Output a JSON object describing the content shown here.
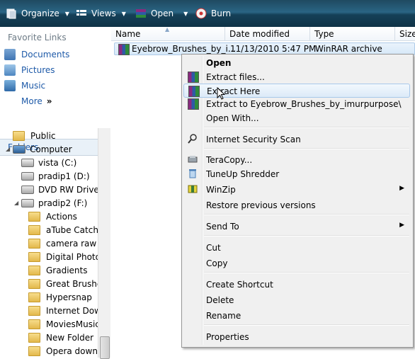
{
  "toolbar": {
    "organize": "Organize",
    "views": "Views",
    "open": "Open",
    "burn": "Burn"
  },
  "nav": {
    "favorite_title": "Favorite Links",
    "favorites": [
      "Documents",
      "Pictures",
      "Music"
    ],
    "more": "More",
    "more_chevrons": "»",
    "folders_title": "Folders",
    "tree": {
      "public": "Public",
      "computer": "Computer",
      "drives": [
        "vista (C:)",
        "pradip1 (D:)",
        "DVD RW Drive (E",
        "pradip2 (F:)"
      ],
      "folders": [
        "Actions",
        "aTube Catcher",
        "camera raw ca",
        "Digital Photos",
        "Gradients",
        "Great Brushes",
        "Hypersnap",
        "Internet Down",
        "MoviesMusic V",
        "New Folder",
        "Opera downlo"
      ]
    }
  },
  "filelist": {
    "columns": [
      "Name",
      "Date modified",
      "Type",
      "Size"
    ],
    "file": {
      "name": "Eyebrow_Brushes_by_i...",
      "date": "11/13/2010 5:47 PM",
      "type": "WinRAR archive"
    }
  },
  "context_menu": {
    "open": "Open",
    "extract_files": "Extract files...",
    "extract_here": "Extract Here",
    "extract_to": "Extract to Eyebrow_Brushes_by_imurpurpose\\",
    "open_with": "Open With...",
    "security_scan": "Internet Security Scan",
    "teracopy": "TeraCopy...",
    "tuneup": "TuneUp Shredder",
    "winzip": "WinZip",
    "restore": "Restore previous versions",
    "send_to": "Send To",
    "cut": "Cut",
    "copy": "Copy",
    "create_shortcut": "Create Shortcut",
    "delete": "Delete",
    "rename": "Rename",
    "properties": "Properties"
  },
  "colors": {
    "toolbar": "#1f4961",
    "link": "#1e5aa8",
    "menu_bg": "#f0f0f0",
    "highlight": "#dceaf8"
  }
}
